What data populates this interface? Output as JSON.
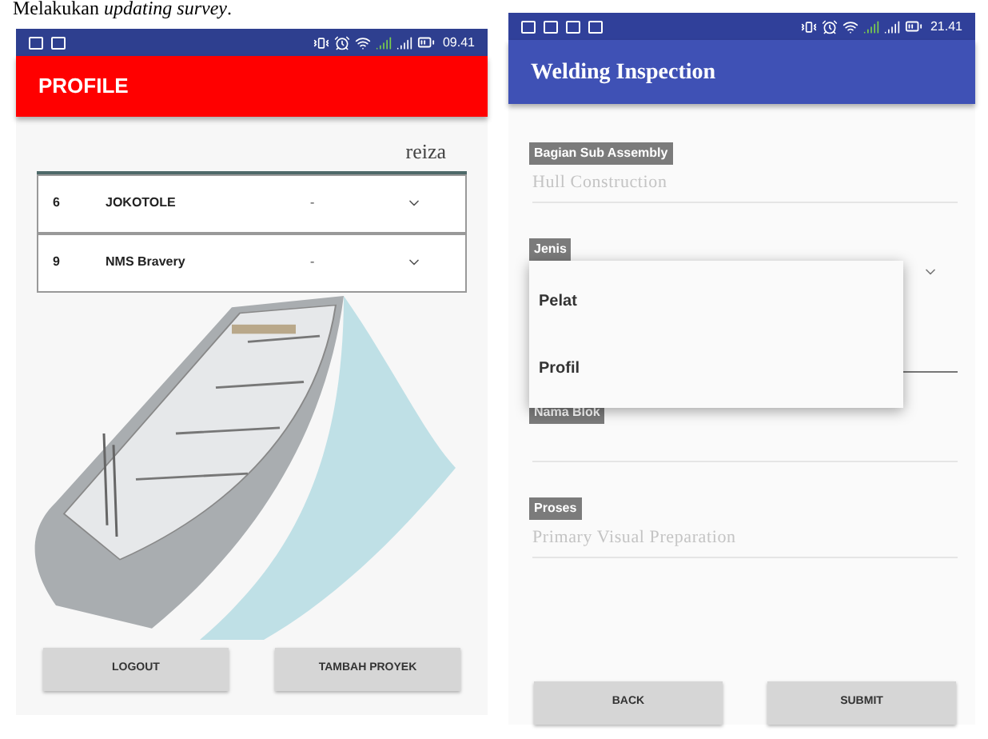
{
  "caption": "Melakukan *updating survey*.",
  "left_phone": {
    "status_bar": {
      "time": "09.41"
    },
    "title": "PROFILE",
    "username": "reiza",
    "projects": [
      {
        "number": "6",
        "name": "JOKOTOLE",
        "status": "-"
      },
      {
        "number": "9",
        "name": "NMS Bravery",
        "status": "-"
      }
    ],
    "buttons": [
      "LOGOUT",
      "TAMBAH PROYEK"
    ]
  },
  "right_phone": {
    "status_bar": {
      "time": "21.41"
    },
    "title": "Welding Inspection",
    "fields": [
      {
        "kind": "text",
        "label": "Bagian Sub Assembly",
        "placeholder": "Hull Construction"
      },
      {
        "kind": "select",
        "label": "Jenis",
        "expanded": true,
        "options": [
          "Pelat",
          "Profil"
        ]
      },
      {
        "kind": "text",
        "label": "Nama Blok"
      },
      {
        "kind": "text",
        "label": "Proses",
        "placeholder": "Primary Visual Preparation"
      }
    ],
    "buttons": [
      "BACK",
      "SUBMIT"
    ]
  }
}
